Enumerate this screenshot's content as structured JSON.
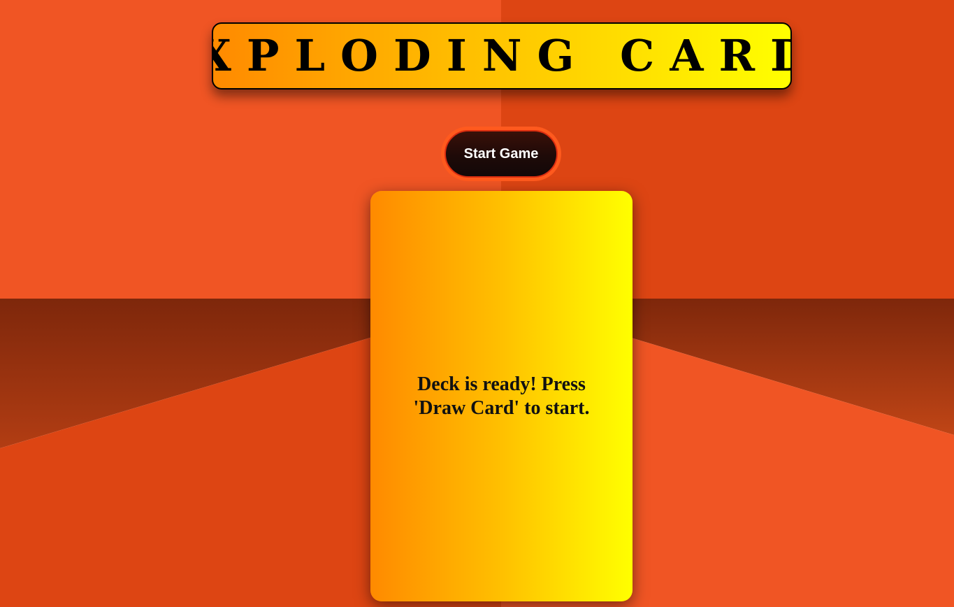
{
  "header": {
    "title": "EXPLODING CARDS"
  },
  "controls": {
    "start_label": "Start Game"
  },
  "card": {
    "message": "Deck is ready! Press 'Draw Card' to start."
  },
  "colors": {
    "bg_primary": "#f05524",
    "bg_secondary": "#dd4513",
    "bg_dark": "#8a2c0d",
    "gradient_start": "#ff8a00",
    "gradient_end": "#ffff00",
    "button_dark": "#1a0a08",
    "button_ring": "#ff5a1e"
  }
}
